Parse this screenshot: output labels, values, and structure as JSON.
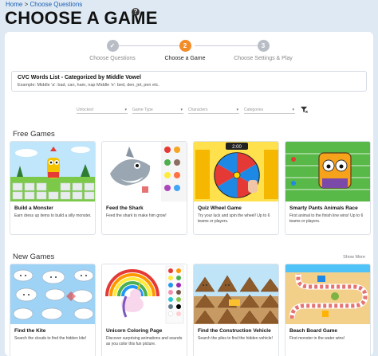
{
  "breadcrumb": {
    "home": "Home",
    "sep": " > ",
    "current": "Choose Questions"
  },
  "page_title": "CHOOSE A GAME",
  "help_icon": "?",
  "stepper": [
    {
      "num": "✓",
      "label": "Choose Questions",
      "state": "done",
      "color": "#b9bec6"
    },
    {
      "num": "2",
      "label": "Choose a Game",
      "state": "active",
      "color": "#f28c28"
    },
    {
      "num": "3",
      "label": "Choose Settings & Play",
      "state": "todo",
      "color": "#b9bec6"
    }
  ],
  "question_list": {
    "title": "CVC Words List - Categorized by Middle Vowel",
    "example": "Example: Middle 'a': bad, can, ham, nap Middle 'e': bed, den, jet, pen etc."
  },
  "filters": [
    "Unlocked",
    "Game Type",
    "Characters",
    "Categories"
  ],
  "sections": {
    "free": {
      "title": "Free Games"
    },
    "new": {
      "title": "New Games",
      "show_more": "Show More"
    }
  },
  "free_games": [
    {
      "name": "Build a Monster",
      "desc": "Earn dress up items to build a silly monster."
    },
    {
      "name": "Feed the Shark",
      "desc": "Feed the shark to make him grow!"
    },
    {
      "name": "Quiz Wheel Game",
      "desc": "Try your luck and spin the wheel! Up to 6 teams or players."
    },
    {
      "name": "Smarty Pants Animals Race",
      "desc": "First animal to the finish line wins! Up to 6 teams or players."
    }
  ],
  "new_games": [
    {
      "name": "Find the Kite",
      "desc": "Search the clouds to find the hidden kite!"
    },
    {
      "name": "Unicorn Coloring Page",
      "desc": "Discover surprising animations and sounds as you color this fun picture."
    },
    {
      "name": "Find the Construction Vehicle",
      "desc": "Search the piles to find the hidden vehicle!"
    },
    {
      "name": "Beach Board Game",
      "desc": "First monster in the water wins!"
    }
  ],
  "wheel_timer": "2:00",
  "colors": {
    "accent": "#f28c28",
    "link": "#1a5fb4",
    "background": "#dfe9f3"
  }
}
